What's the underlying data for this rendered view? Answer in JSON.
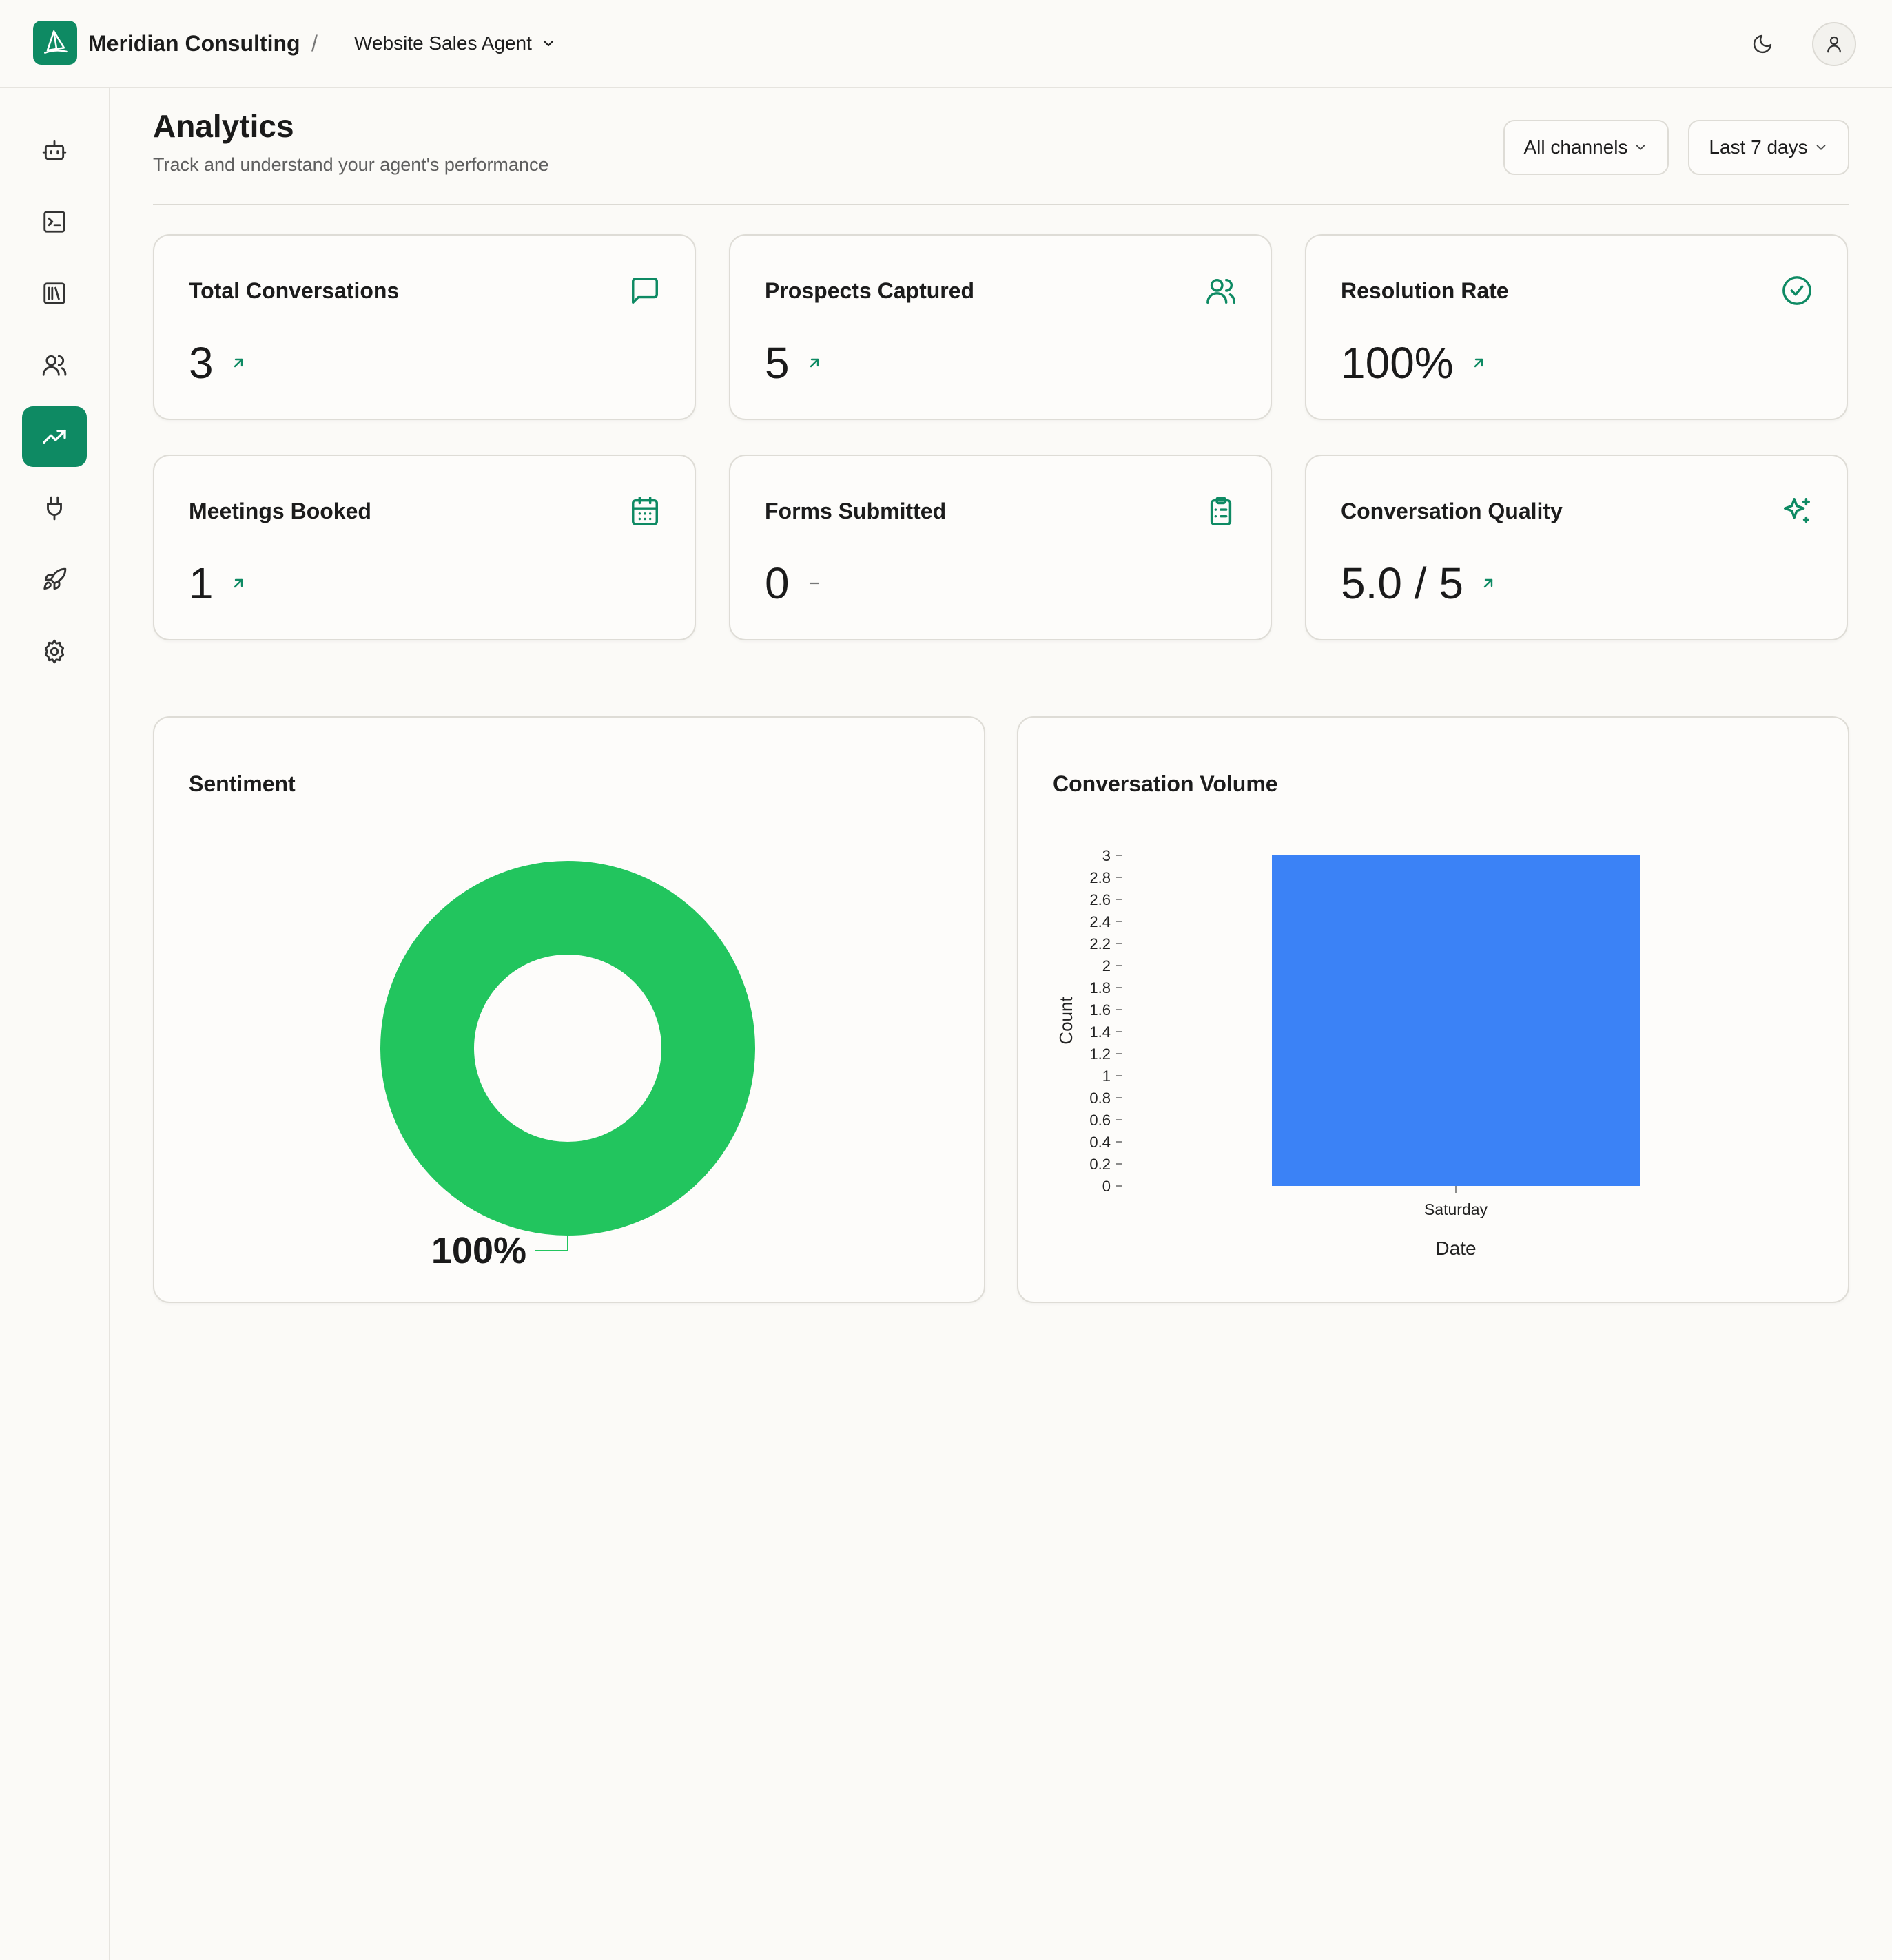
{
  "header": {
    "org_name": "Meridian Consulting",
    "separator": "/",
    "agent_name": "Website Sales Agent",
    "logo_icon": "sailboat-icon",
    "theme_icon": "moon-icon",
    "account_icon": "user-icon"
  },
  "sidebar": {
    "items": [
      {
        "name": "agent",
        "icon": "bot-icon",
        "active": false
      },
      {
        "name": "console",
        "icon": "terminal-icon",
        "active": false
      },
      {
        "name": "library",
        "icon": "library-icon",
        "active": false
      },
      {
        "name": "contacts",
        "icon": "users-icon",
        "active": false
      },
      {
        "name": "analytics",
        "icon": "trending-up-icon",
        "active": true
      },
      {
        "name": "integrations",
        "icon": "plug-icon",
        "active": false
      },
      {
        "name": "deploy",
        "icon": "rocket-icon",
        "active": false
      },
      {
        "name": "settings",
        "icon": "gear-icon",
        "active": false
      }
    ]
  },
  "page": {
    "title": "Analytics",
    "subtitle": "Track and understand your agent's performance"
  },
  "filters": {
    "channel": "All channels",
    "range": "Last 7 days"
  },
  "stats": [
    {
      "title": "Total Conversations",
      "value": "3",
      "trend": "up",
      "icon": "message-square-icon"
    },
    {
      "title": "Prospects Captured",
      "value": "5",
      "trend": "up",
      "icon": "users-icon"
    },
    {
      "title": "Resolution Rate",
      "value": "100%",
      "trend": "up",
      "icon": "check-circle-icon"
    },
    {
      "title": "Meetings Booked",
      "value": "1",
      "trend": "up",
      "icon": "calendar-icon"
    },
    {
      "title": "Forms Submitted",
      "value": "0",
      "trend": "flat",
      "icon": "clipboard-list-icon"
    },
    {
      "title": "Conversation Quality",
      "value": "5.0 / 5",
      "trend": "up",
      "icon": "sparkles-icon"
    }
  ],
  "colors": {
    "accent": "#0e8a63",
    "positive": "#22c55e",
    "bar": "#3b82f6"
  },
  "chart_data": [
    {
      "type": "pie",
      "title": "Sentiment",
      "donut": true,
      "series": [
        {
          "name": "",
          "values": [
            100
          ]
        }
      ],
      "data_labels": [
        "100%"
      ],
      "colors": [
        "#22c55e"
      ]
    },
    {
      "type": "bar",
      "title": "Conversation Volume",
      "categories": [
        "Saturday"
      ],
      "values": [
        3
      ],
      "xlabel": "Date",
      "ylabel": "Count",
      "ylim": [
        0,
        3
      ],
      "yticks": [
        "0",
        "0.2",
        "0.4",
        "0.6",
        "0.8",
        "1",
        "1.2",
        "1.4",
        "1.6",
        "1.8",
        "2",
        "2.2",
        "2.4",
        "2.6",
        "2.8",
        "3"
      ],
      "grid": false,
      "colors": [
        "#3b82f6"
      ]
    }
  ]
}
